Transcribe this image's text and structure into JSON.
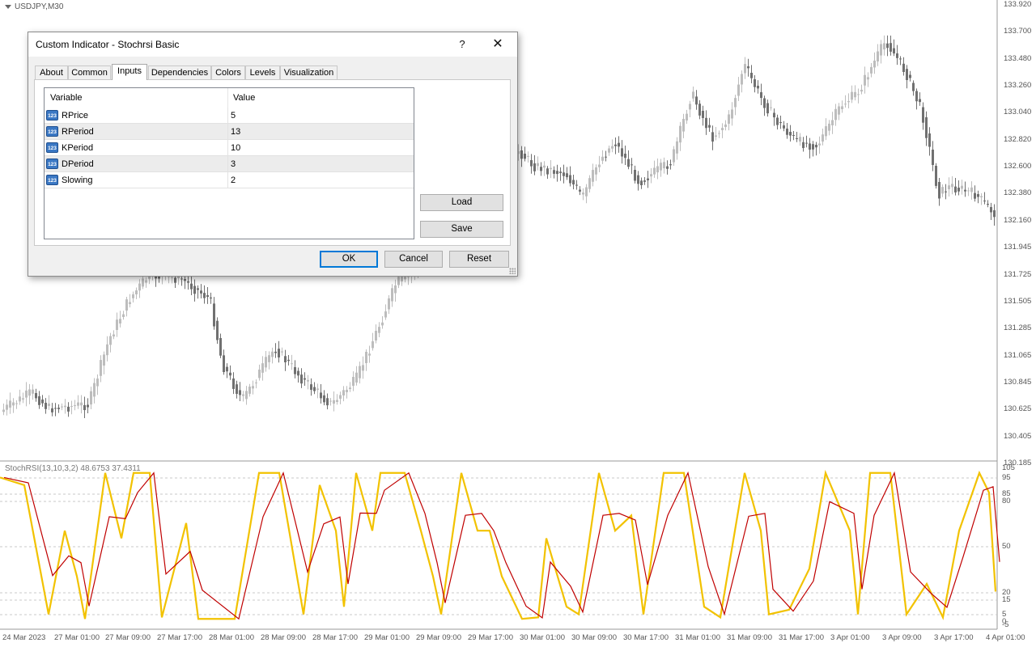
{
  "chart": {
    "symbol_title": "USDJPY,M30",
    "indicator_label": "StochRSI(13,10,3,2) 48.6753 37.4311",
    "price_axis": [
      "133.920",
      "133.700",
      "133.480",
      "133.260",
      "133.040",
      "132.820",
      "132.600",
      "132.380",
      "132.160",
      "131.945",
      "131.725",
      "131.505",
      "131.285",
      "131.065",
      "130.845",
      "130.625",
      "130.405",
      "130.185"
    ],
    "osc_axis": [
      "105",
      "95",
      "85",
      "80",
      "50",
      "20",
      "15",
      "5",
      "0",
      "-5"
    ],
    "time_axis": [
      "24 Mar 2023",
      "27 Mar 01:00",
      "27 Mar 09:00",
      "27 Mar 17:00",
      "28 Mar 01:00",
      "28 Mar 09:00",
      "28 Mar 17:00",
      "29 Mar 01:00",
      "29 Mar 09:00",
      "29 Mar 17:00",
      "30 Mar 01:00",
      "30 Mar 09:00",
      "30 Mar 17:00",
      "31 Mar 01:00",
      "31 Mar 09:00",
      "31 Mar 17:00",
      "3 Apr 01:00",
      "3 Apr 09:00",
      "3 Apr 17:00",
      "4 Apr 01:00"
    ],
    "colors": {
      "candle_up": "#bdbdbd",
      "candle_down": "#707070",
      "k_line": "#f2c200",
      "d_line": "#c00000",
      "grid": "#c8c8c8"
    }
  },
  "dialog": {
    "title": "Custom Indicator - Stochrsi Basic",
    "help_label": "?",
    "close_label": "✕",
    "tabs": [
      {
        "label": "About",
        "active": false
      },
      {
        "label": "Common",
        "active": false
      },
      {
        "label": "Inputs",
        "active": true
      },
      {
        "label": "Dependencies",
        "active": false
      },
      {
        "label": "Colors",
        "active": false
      },
      {
        "label": "Levels",
        "active": false
      },
      {
        "label": "Visualization",
        "active": false
      }
    ],
    "grid": {
      "header_variable": "Variable",
      "header_value": "Value",
      "rows": [
        {
          "icon": "123",
          "variable": "RPrice",
          "value": "5"
        },
        {
          "icon": "123",
          "variable": "RPeriod",
          "value": "13"
        },
        {
          "icon": "123",
          "variable": "KPeriod",
          "value": "10"
        },
        {
          "icon": "123",
          "variable": "DPeriod",
          "value": "3"
        },
        {
          "icon": "123",
          "variable": "Slowing",
          "value": "2"
        }
      ]
    },
    "load_label": "Load",
    "save_label": "Save",
    "ok_label": "OK",
    "cancel_label": "Cancel",
    "reset_label": "Reset"
  }
}
